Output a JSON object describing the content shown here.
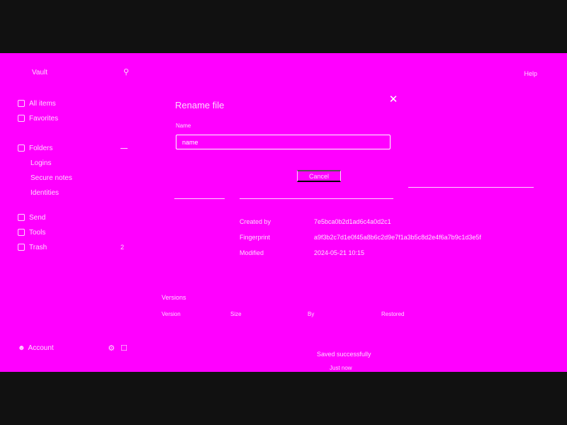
{
  "sidebar": {
    "title": "Vault",
    "search_icon": "search-icon",
    "items": [
      {
        "label": "All items",
        "icon": "grid-icon"
      },
      {
        "label": "Favorites",
        "icon": "star-icon"
      },
      {
        "label": "Folders",
        "icon": "folder-icon"
      },
      {
        "label": "Logins",
        "icon": "key-icon"
      },
      {
        "label": "Secure notes",
        "icon": "note-icon"
      },
      {
        "label": "Identities",
        "icon": "id-icon"
      },
      {
        "label": "Send",
        "icon": "send-icon"
      },
      {
        "label": "Tools",
        "icon": "tools-icon"
      },
      {
        "label": "Trash",
        "icon": "trash-icon"
      }
    ],
    "trash_count": "2",
    "footer_user": "Account",
    "footer_actions": [
      "settings-icon",
      "lock-icon"
    ]
  },
  "top_right": {
    "label": "Help"
  },
  "dialog": {
    "title": "Rename file",
    "field_label": "Name",
    "field_value": "name",
    "cancel_label": "Cancel"
  },
  "details": [
    {
      "key": "Created by",
      "value": "7e5bca0b2d1ad6c4a0d2c1"
    },
    {
      "key": "Fingerprint",
      "value": "a9f3b2c7d1e0f45a8b6c2d9e7f1a3b5c8d2e4f6a7b9c1d3e5f"
    },
    {
      "key": "Modified",
      "value": "2024-05-21 10:15"
    }
  ],
  "lower": {
    "section_label": "Versions",
    "columns": [
      "Version",
      "Size",
      "By",
      "Restored"
    ],
    "toast": "Saved successfully",
    "toast_sub": "Just now"
  },
  "colors": {
    "canvas": "#ff00ff",
    "letterbox": "#111111",
    "text": "#ffd7ff"
  }
}
